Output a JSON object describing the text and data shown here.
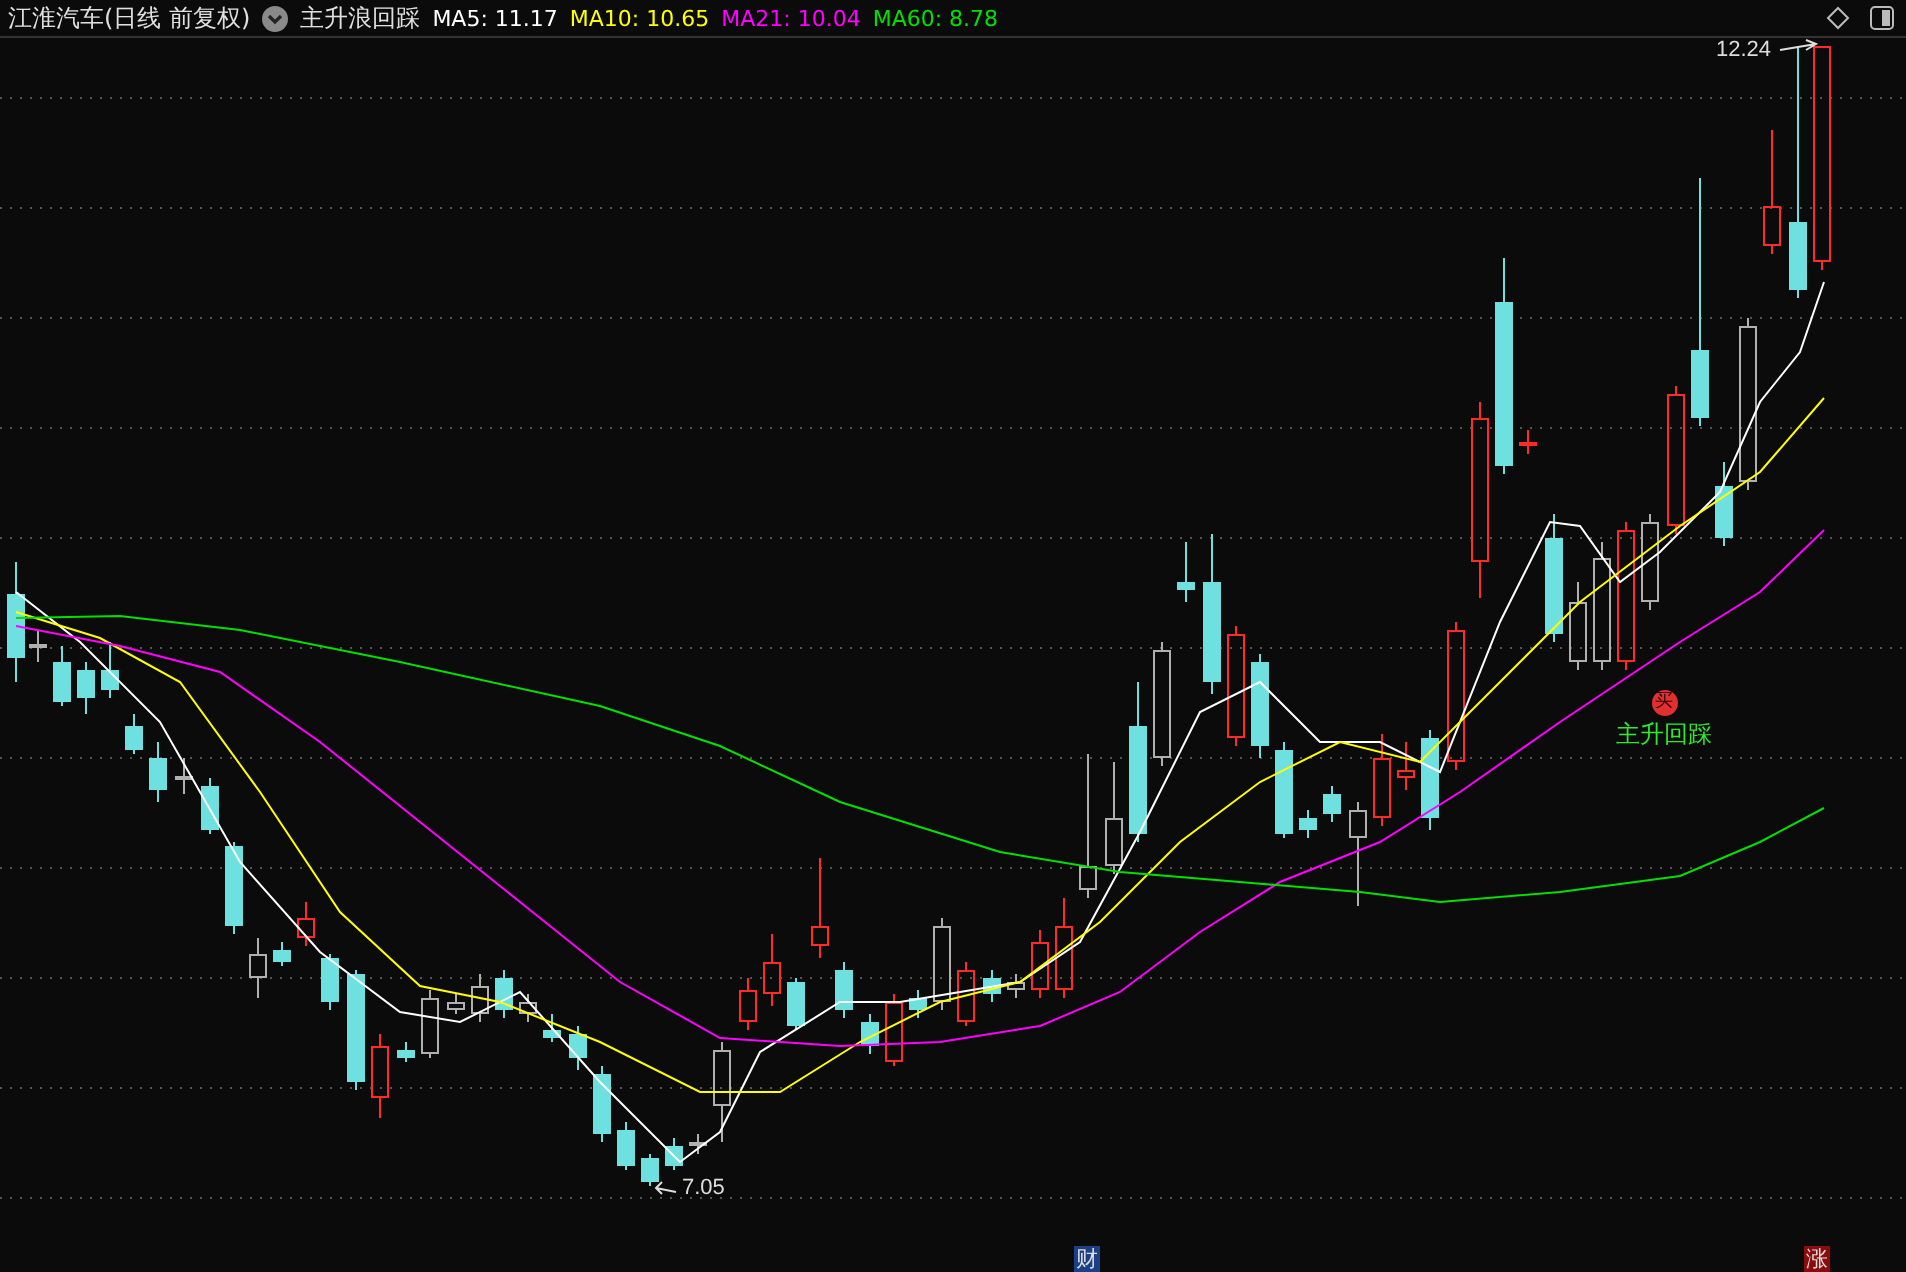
{
  "header": {
    "title": "江淮汽车(日线 前复权)",
    "indicator": "主升浪回踩",
    "moving_averages": [
      {
        "label": "MA5: 11.17",
        "color": "#ffffff"
      },
      {
        "label": "MA10: 10.65",
        "color": "#ffff00"
      },
      {
        "label": "MA21: 10.04",
        "color": "#ff00ff"
      },
      {
        "label": "MA60: 8.78",
        "color": "#00e000"
      }
    ]
  },
  "chart": {
    "high_label": "12.24",
    "low_label": "7.05",
    "signal": {
      "badge": "买",
      "label": "主升回踩"
    }
  },
  "markers": [
    {
      "text": "财",
      "color": "#1d3f86"
    },
    {
      "text": "涨",
      "color": "#8a0c0c"
    }
  ]
}
